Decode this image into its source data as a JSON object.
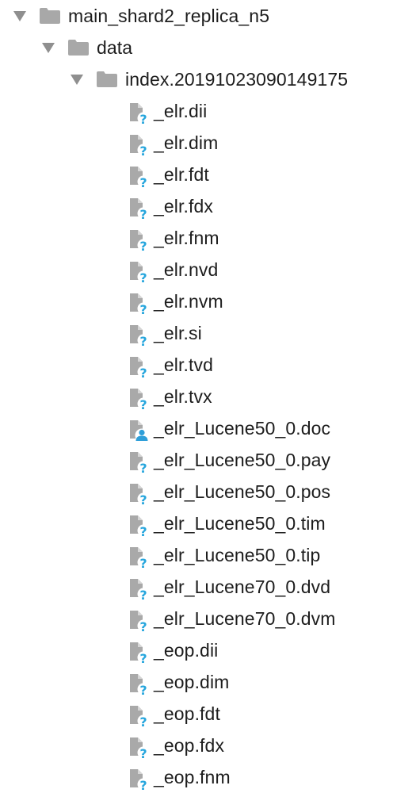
{
  "tree": {
    "root": {
      "label": "main_shard2_replica_n5",
      "icon": "folder-icon",
      "expanded": true
    },
    "data_folder": {
      "label": "data",
      "icon": "folder-icon",
      "expanded": true
    },
    "index_folder": {
      "label": "index.20191023090149175",
      "icon": "folder-icon",
      "expanded": true
    },
    "files": [
      {
        "label": "_elr.dii",
        "icon": "unknown-file-icon"
      },
      {
        "label": "_elr.dim",
        "icon": "unknown-file-icon"
      },
      {
        "label": "_elr.fdt",
        "icon": "unknown-file-icon"
      },
      {
        "label": "_elr.fdx",
        "icon": "unknown-file-icon"
      },
      {
        "label": "_elr.fnm",
        "icon": "unknown-file-icon"
      },
      {
        "label": "_elr.nvd",
        "icon": "unknown-file-icon"
      },
      {
        "label": "_elr.nvm",
        "icon": "unknown-file-icon"
      },
      {
        "label": "_elr.si",
        "icon": "unknown-file-icon"
      },
      {
        "label": "_elr.tvd",
        "icon": "unknown-file-icon"
      },
      {
        "label": "_elr.tvx",
        "icon": "unknown-file-icon"
      },
      {
        "label": "_elr_Lucene50_0.doc",
        "icon": "user-file-icon"
      },
      {
        "label": "_elr_Lucene50_0.pay",
        "icon": "unknown-file-icon"
      },
      {
        "label": "_elr_Lucene50_0.pos",
        "icon": "unknown-file-icon"
      },
      {
        "label": "_elr_Lucene50_0.tim",
        "icon": "unknown-file-icon"
      },
      {
        "label": "_elr_Lucene50_0.tip",
        "icon": "unknown-file-icon"
      },
      {
        "label": "_elr_Lucene70_0.dvd",
        "icon": "unknown-file-icon"
      },
      {
        "label": "_elr_Lucene70_0.dvm",
        "icon": "unknown-file-icon"
      },
      {
        "label": "_eop.dii",
        "icon": "unknown-file-icon"
      },
      {
        "label": "_eop.dim",
        "icon": "unknown-file-icon"
      },
      {
        "label": "_eop.fdt",
        "icon": "unknown-file-icon"
      },
      {
        "label": "_eop.fdx",
        "icon": "unknown-file-icon"
      },
      {
        "label": "_eop.fnm",
        "icon": "unknown-file-icon"
      }
    ]
  },
  "colors": {
    "text": "#1d1d1d",
    "folder": "#a8a8a8",
    "arrow": "#8f8f8f",
    "file_page": "#a9a9a9",
    "question_mark": "#27a6dd",
    "user_badge": "#2f9fd9"
  }
}
